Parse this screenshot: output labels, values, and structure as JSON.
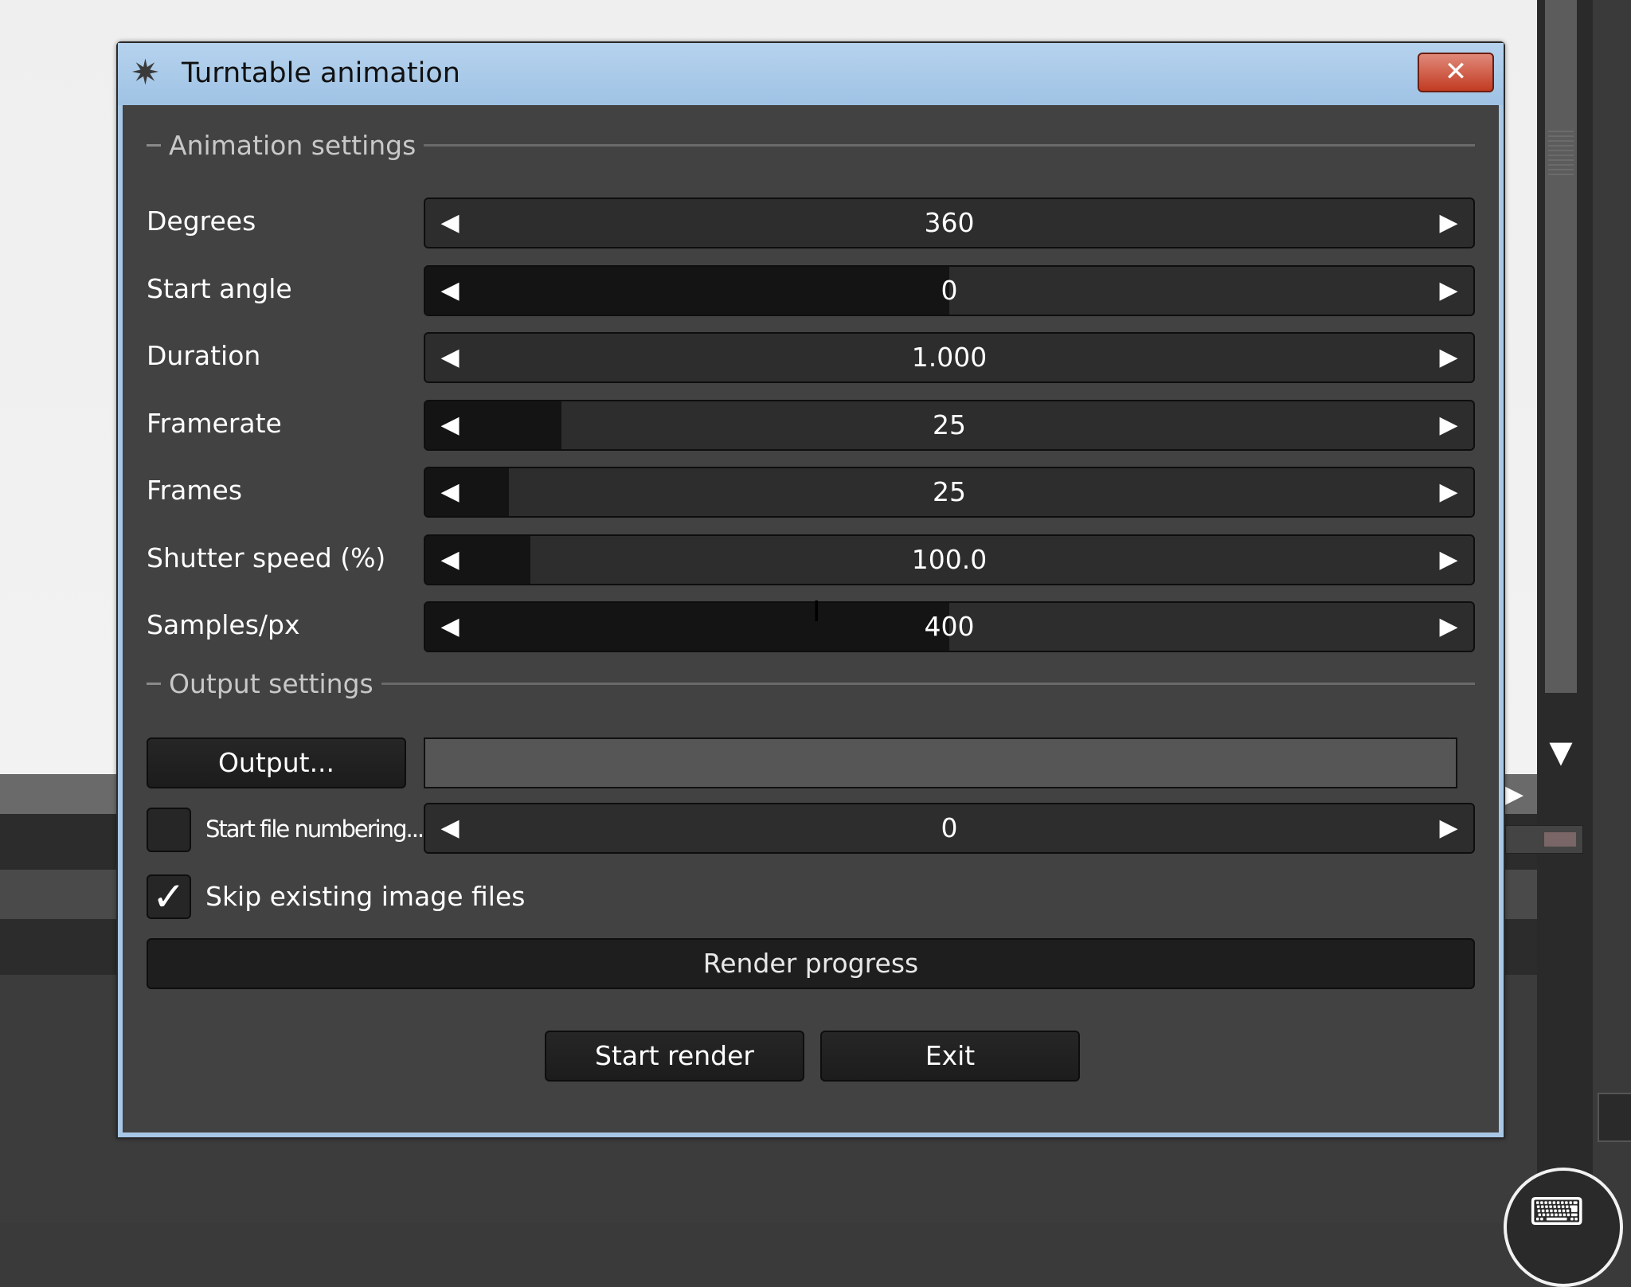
{
  "dialog": {
    "title": "Turntable animation",
    "close_label": "✕"
  },
  "animation_settings": {
    "header": "Animation settings",
    "fields": [
      {
        "label": "Degrees",
        "value": "360",
        "fill_fraction": 0.0
      },
      {
        "label": "Start angle",
        "value": "0",
        "fill_fraction": 0.5
      },
      {
        "label": "Duration",
        "value": "1.000",
        "fill_fraction": 0.0
      },
      {
        "label": "Framerate",
        "value": "25",
        "fill_fraction": 0.13
      },
      {
        "label": "Frames",
        "value": "25",
        "fill_fraction": 0.08
      },
      {
        "label": "Shutter speed (%)",
        "value": "100.0",
        "fill_fraction": 0.1
      },
      {
        "label": "Samples/px",
        "value": "400",
        "fill_fraction": 0.5
      }
    ]
  },
  "output_settings": {
    "header": "Output settings",
    "output_button": "Output...",
    "output_path": "",
    "start_numbering_label": "Start file numbering...",
    "start_numbering_checked": false,
    "start_numbering_value": "0",
    "skip_existing_label": "Skip existing image files",
    "skip_existing_checked": true
  },
  "render": {
    "progress_label": "Render progress",
    "start_button": "Start render",
    "exit_button": "Exit"
  },
  "icons": {
    "app": "turntable-app-icon",
    "arrow_left": "◀",
    "arrow_right": "▶",
    "check": "✓",
    "keyboard": "⌨"
  }
}
